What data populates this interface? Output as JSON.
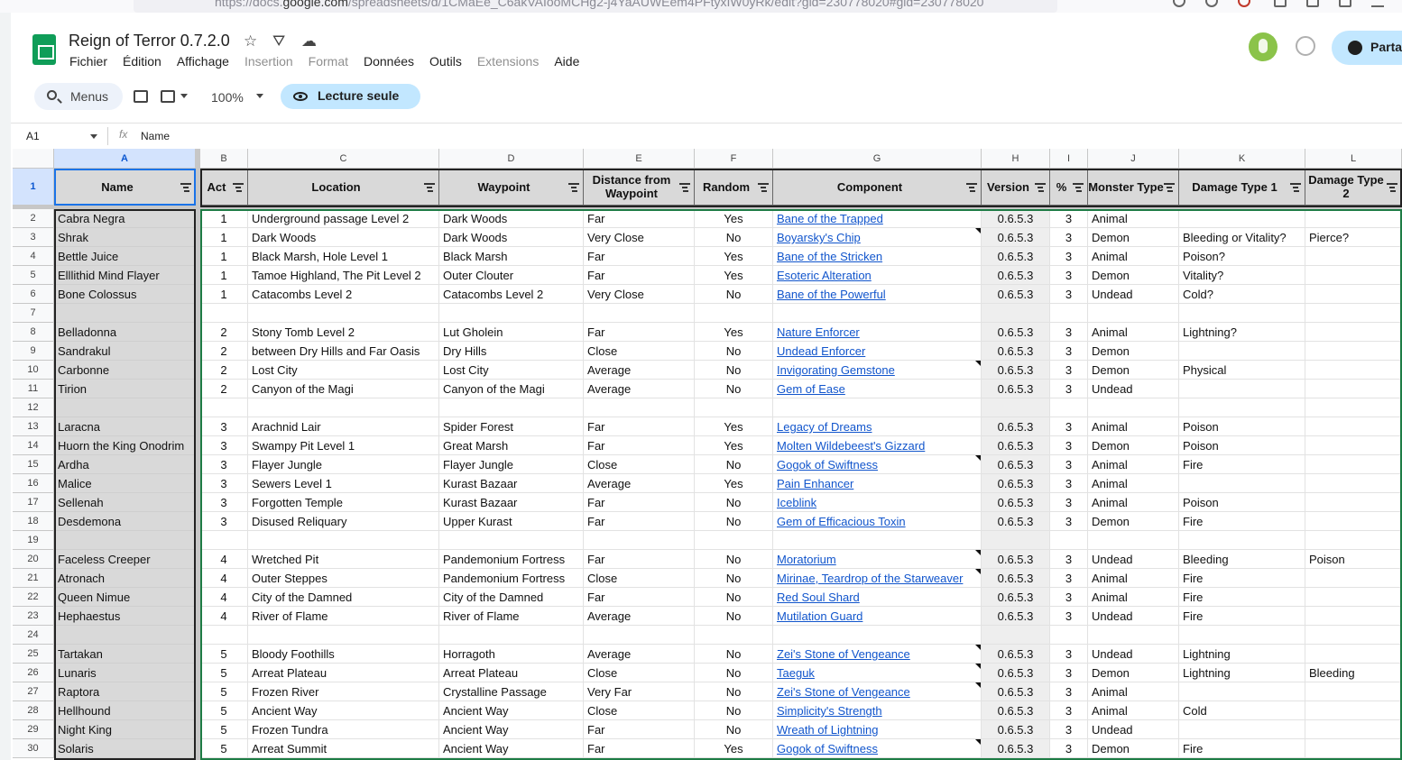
{
  "browser": {
    "url_prefix": "https://docs.",
    "url_domain": "google.com",
    "url_rest": "/spreadsheets/d/1CMaEe_C6akVAIooMCHg2-j4YaAUWEem4PFtyxIW0yRk/edit?gid=230778020#gid=230778020"
  },
  "header": {
    "title": "Reign of Terror 0.7.2.0",
    "menus": [
      {
        "label": "Fichier",
        "disabled": false
      },
      {
        "label": "Édition",
        "disabled": false
      },
      {
        "label": "Affichage",
        "disabled": false
      },
      {
        "label": "Insertion",
        "disabled": true
      },
      {
        "label": "Format",
        "disabled": true
      },
      {
        "label": "Données",
        "disabled": false
      },
      {
        "label": "Outils",
        "disabled": false
      },
      {
        "label": "Extensions",
        "disabled": true
      },
      {
        "label": "Aide",
        "disabled": false
      }
    ],
    "share_label": "Parta",
    "icons": [
      "star-icon",
      "move-to-drive-icon",
      "cloud-status-icon",
      "history-icon",
      "globe-icon"
    ]
  },
  "toolbar": {
    "menus_label": "Menus",
    "zoom": "100%",
    "readonly_label": "Lecture seule"
  },
  "formula_bar": {
    "cell_ref": "A1",
    "fx": "fx",
    "content": "Name"
  },
  "sheet": {
    "column_letters": [
      "A",
      "B",
      "C",
      "D",
      "E",
      "F",
      "G",
      "H",
      "I",
      "J",
      "K",
      "L"
    ],
    "headers": [
      "Name",
      "Act",
      "Location",
      "Waypoint",
      "Distance from Waypoint",
      "Random",
      "Component",
      "Version",
      "%",
      "Monster Type",
      "Damage Type 1",
      "Damage Type 2"
    ],
    "rows": [
      {
        "n": "2",
        "c": [
          "Cabra Negra",
          "1",
          "Underground passage Level 2",
          "Dark Woods",
          "Far",
          "Yes",
          "Bane of the Trapped",
          "0.6.5.3",
          "3",
          "Animal",
          "",
          ""
        ]
      },
      {
        "n": "3",
        "c": [
          "Shrak",
          "1",
          "Dark Woods",
          "Dark Woods",
          "Very Close",
          "No",
          "Boyarsky's Chip",
          "0.6.5.3",
          "3",
          "Demon",
          "Bleeding or Vitality?",
          "Pierce?"
        ]
      },
      {
        "n": "4",
        "c": [
          "Bettle Juice",
          "1",
          "Black Marsh, Hole Level 1",
          "Black Marsh",
          "Far",
          "Yes",
          "Bane of the Stricken",
          "0.6.5.3",
          "3",
          "Animal",
          "Poison?",
          ""
        ]
      },
      {
        "n": "5",
        "c": [
          "Elllithid Mind Flayer",
          "1",
          "Tamoe Highland, The Pit Level 2",
          "Outer Clouter",
          "Far",
          "Yes",
          "Esoteric Alteration",
          "0.6.5.3",
          "3",
          "Demon",
          "Vitality?",
          ""
        ]
      },
      {
        "n": "6",
        "c": [
          "Bone Colossus",
          "1",
          "Catacombs Level 2",
          "Catacombs Level 2",
          "Very Close",
          "No",
          "Bane of the Powerful",
          "0.6.5.3",
          "3",
          "Undead",
          "Cold?",
          ""
        ]
      },
      {
        "n": "7",
        "c": [
          "",
          "",
          "",
          "",
          "",
          "",
          "",
          "",
          "",
          "",
          "",
          ""
        ]
      },
      {
        "n": "8",
        "c": [
          "Belladonna",
          "2",
          "Stony Tomb Level 2",
          "Lut Gholein",
          "Far",
          "Yes",
          "Nature Enforcer",
          "0.6.5.3",
          "3",
          "Animal",
          "Lightning?",
          ""
        ]
      },
      {
        "n": "9",
        "c": [
          "Sandrakul",
          "2",
          "between Dry Hills and Far Oasis",
          "Dry Hills",
          "Close",
          "No",
          "Undead Enforcer",
          "0.6.5.3",
          "3",
          "Demon",
          "",
          ""
        ]
      },
      {
        "n": "10",
        "c": [
          "Carbonne",
          "2",
          "Lost City",
          "Lost City",
          "Average",
          "No",
          "Invigorating Gemstone",
          "0.6.5.3",
          "3",
          "Demon",
          "Physical",
          ""
        ]
      },
      {
        "n": "11",
        "c": [
          "Tirion",
          "2",
          "Canyon of the Magi",
          "Canyon of the Magi",
          "Average",
          "No",
          "Gem of Ease",
          "0.6.5.3",
          "3",
          "Undead",
          "",
          ""
        ]
      },
      {
        "n": "12",
        "c": [
          "",
          "",
          "",
          "",
          "",
          "",
          "",
          "",
          "",
          "",
          "",
          ""
        ]
      },
      {
        "n": "13",
        "c": [
          "Laracna",
          "3",
          "Arachnid Lair",
          "Spider Forest",
          "Far",
          "Yes",
          "Legacy of Dreams",
          "0.6.5.3",
          "3",
          "Animal",
          "Poison",
          ""
        ]
      },
      {
        "n": "14",
        "c": [
          "Huorn the King Onodrim",
          "3",
          "Swampy Pit Level 1",
          "Great Marsh",
          "Far",
          "Yes",
          "Molten Wildebeest's Gizzard",
          "0.6.5.3",
          "3",
          "Demon",
          "Poison",
          ""
        ]
      },
      {
        "n": "15",
        "c": [
          "Ardha",
          "3",
          "Flayer Jungle",
          "Flayer Jungle",
          "Close",
          "No",
          "Gogok of Swiftness",
          "0.6.5.3",
          "3",
          "Animal",
          "Fire",
          ""
        ]
      },
      {
        "n": "16",
        "c": [
          "Malice",
          "3",
          "Sewers Level 1",
          "Kurast Bazaar",
          "Average",
          "Yes",
          "Pain Enhancer",
          "0.6.5.3",
          "3",
          "Animal",
          "",
          ""
        ]
      },
      {
        "n": "17",
        "c": [
          "Sellenah",
          "3",
          "Forgotten Temple",
          "Kurast Bazaar",
          "Far",
          "No",
          "Iceblink",
          "0.6.5.3",
          "3",
          "Animal",
          "Poison",
          ""
        ]
      },
      {
        "n": "18",
        "c": [
          "Desdemona",
          "3",
          "Disused Reliquary",
          "Upper Kurast",
          "Far",
          "No",
          "Gem of Efficacious Toxin",
          "0.6.5.3",
          "3",
          "Demon",
          "Fire",
          ""
        ]
      },
      {
        "n": "19",
        "c": [
          "",
          "",
          "",
          "",
          "",
          "",
          "",
          "",
          "",
          "",
          "",
          ""
        ]
      },
      {
        "n": "20",
        "c": [
          "Faceless Creeper",
          "4",
          "Wretched Pit",
          "Pandemonium Fortress",
          "Far",
          "No",
          "Moratorium",
          "0.6.5.3",
          "3",
          "Undead",
          "Bleeding",
          "Poison"
        ]
      },
      {
        "n": "21",
        "c": [
          "Atronach",
          "4",
          "Outer Steppes",
          "Pandemonium Fortress",
          "Close",
          "No",
          "Mirinae, Teardrop of the Starweaver",
          "0.6.5.3",
          "3",
          "Animal",
          "Fire",
          ""
        ]
      },
      {
        "n": "22",
        "c": [
          "Queen Nimue",
          "4",
          "City of the Damned",
          "City of the Damned",
          "Far",
          "No",
          "Red Soul Shard",
          "0.6.5.3",
          "3",
          "Animal",
          "Fire",
          ""
        ]
      },
      {
        "n": "23",
        "c": [
          "Hephaestus",
          "4",
          "River of Flame",
          "River of Flame",
          "Average",
          "No",
          "Mutilation Guard",
          "0.6.5.3",
          "3",
          "Undead",
          "Fire",
          ""
        ]
      },
      {
        "n": "24",
        "c": [
          "",
          "",
          "",
          "",
          "",
          "",
          "",
          "",
          "",
          "",
          "",
          ""
        ]
      },
      {
        "n": "25",
        "c": [
          "Tartakan",
          "5",
          "Bloody Foothills",
          "Horragoth",
          "Average",
          "No",
          "Zei's Stone of Vengeance",
          "0.6.5.3",
          "3",
          "Undead",
          "Lightning",
          ""
        ]
      },
      {
        "n": "26",
        "c": [
          "Lunaris",
          "5",
          "Arreat Plateau",
          "Arreat Plateau",
          "Close",
          "No",
          "Taeguk",
          "0.6.5.3",
          "3",
          "Demon",
          "Lightning",
          "Bleeding"
        ]
      },
      {
        "n": "27",
        "c": [
          "Raptora",
          "5",
          "Frozen River",
          "Crystalline Passage",
          "Very Far",
          "No",
          "Zei's Stone of Vengeance",
          "0.6.5.3",
          "3",
          "Animal",
          "",
          ""
        ]
      },
      {
        "n": "28",
        "c": [
          "Hellhound",
          "5",
          "Ancient Way",
          "Ancient Way",
          "Close",
          "No",
          "Simplicity's Strength",
          "0.6.5.3",
          "3",
          "Animal",
          "Cold",
          ""
        ]
      },
      {
        "n": "29",
        "c": [
          "Night King",
          "5",
          "Frozen Tundra",
          "Ancient Way",
          "Far",
          "No",
          "Wreath of Lightning",
          "0.6.5.3",
          "3",
          "Undead",
          "",
          ""
        ]
      },
      {
        "n": "30",
        "c": [
          "Solaris",
          "5",
          "Arreat Summit",
          "Ancient Way",
          "Far",
          "Yes",
          "Gogok of Swiftness",
          "0.6.5.3",
          "3",
          "Demon",
          "Fire",
          ""
        ]
      }
    ],
    "notes_rows": [
      "3",
      "10",
      "15",
      "20",
      "21",
      "25",
      "26",
      "27",
      "30"
    ]
  },
  "colors": {
    "accent": "#1a73e8",
    "link": "#1155cc",
    "header_fill": "#d9d9d9",
    "selection": "#d3e3fd",
    "sheets_green": "#0f9d58"
  }
}
